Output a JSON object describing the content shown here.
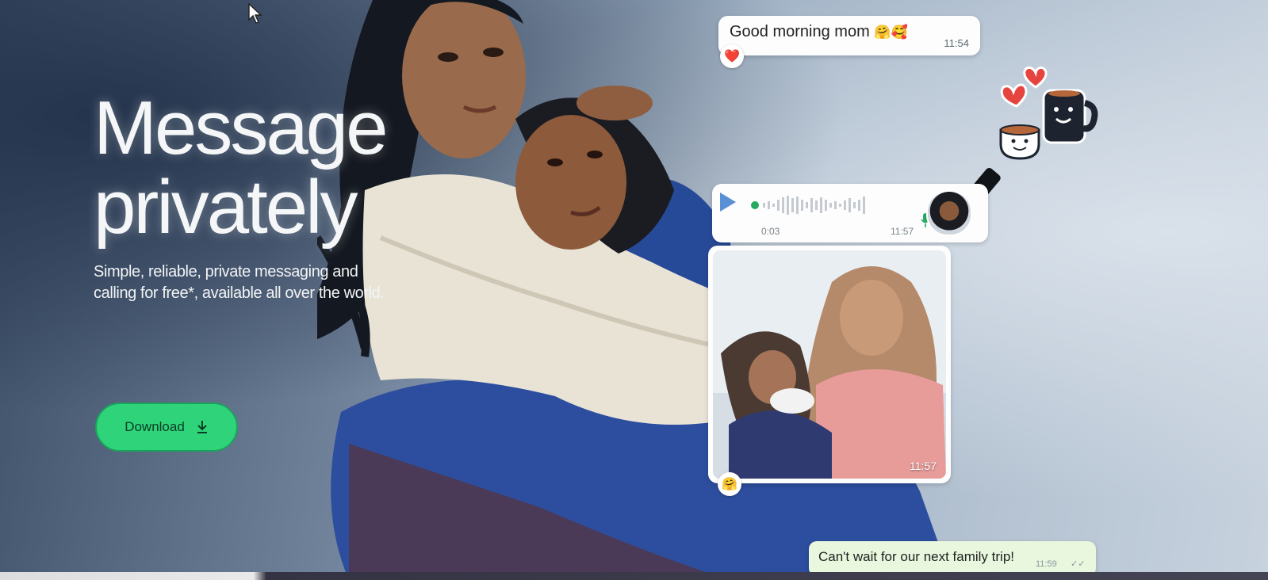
{
  "hero": {
    "title_line1": "Message",
    "title_line2": "privately",
    "subtitle": "Simple, reliable, private messaging and calling for free*, available all over the world.",
    "download_label": "Download"
  },
  "chat": {
    "greeting": {
      "text": "Good morning mom",
      "emoji": "🤗🥰",
      "time": "11:54",
      "reaction": "❤️"
    },
    "voice_note": {
      "duration": "0:03",
      "time": "11:57"
    },
    "photo_message": {
      "time": "11:57",
      "reaction": "🤗"
    },
    "reply": {
      "text": "Can't wait for our next family trip!",
      "time": "11:59"
    }
  },
  "colors": {
    "brand_green": "#2fd47a",
    "bubble_white": "#fdfdfd",
    "bubble_outgoing": "#e8f7dd"
  },
  "icons": {
    "download": "download-arrow-icon",
    "play": "play-icon",
    "mic": "microphone-icon",
    "stickers": "heart-and-coffee-cups-sticker"
  }
}
